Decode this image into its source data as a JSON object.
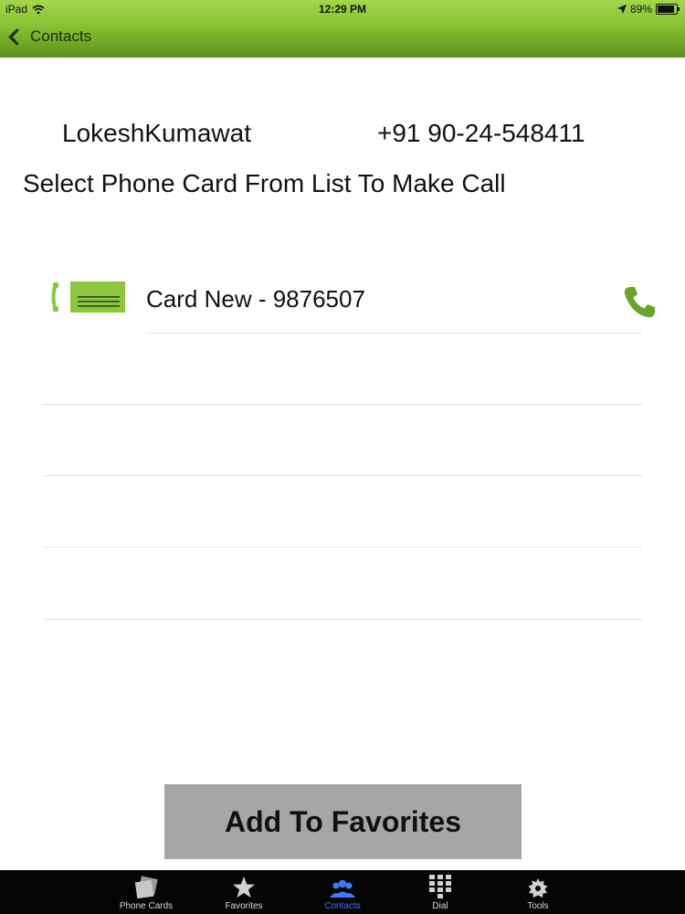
{
  "status": {
    "device": "iPad",
    "time": "12:29 PM",
    "battery": "89%",
    "battery_level": 0.89
  },
  "nav": {
    "back_label": "Contacts"
  },
  "contact": {
    "name": "LokeshKumawat",
    "phone": "+91 90-24-548411"
  },
  "instruction": "Select Phone Card From List To Make Call",
  "cards": [
    {
      "label": "Card New - 9876507",
      "icon": "phone-card-icon",
      "action_icon": "call-icon"
    }
  ],
  "actions": {
    "add_favorites": "Add To Favorites"
  },
  "tabbar": {
    "tabs": [
      {
        "label": "Phone Cards",
        "icon": "phone-cards-icon",
        "active": false
      },
      {
        "label": "Favorites",
        "icon": "star-icon",
        "active": false
      },
      {
        "label": "Contacts",
        "icon": "contacts-icon",
        "active": true
      },
      {
        "label": "Dial",
        "icon": "dialpad-icon",
        "active": false
      },
      {
        "label": "Tools",
        "icon": "gear-icon",
        "active": false
      }
    ]
  },
  "colors": {
    "header_green": "#86c232",
    "card_green": "#8cc63f",
    "tab_active": "#3a7bff"
  }
}
